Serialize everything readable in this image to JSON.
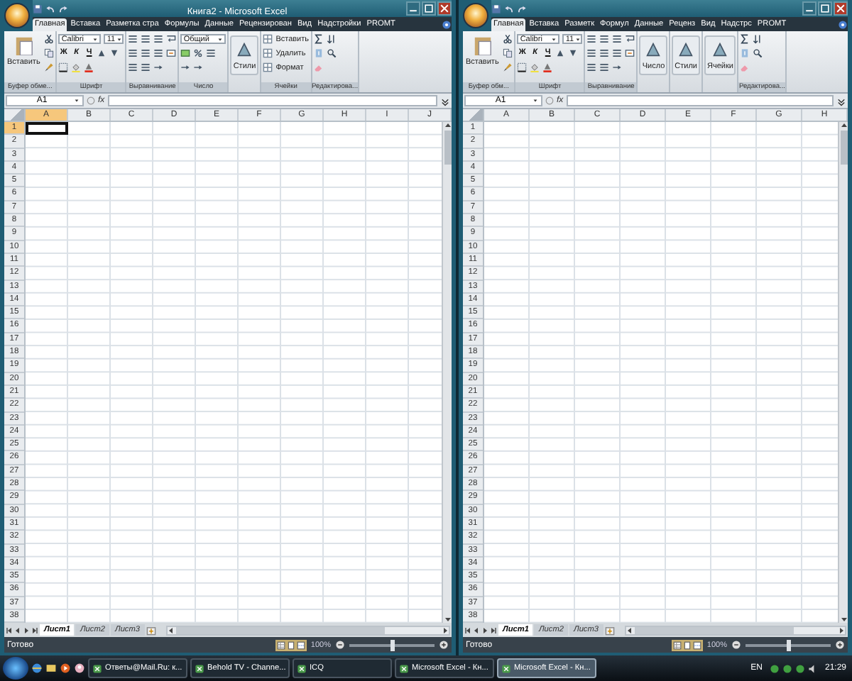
{
  "windows": [
    {
      "title": "Книга2 - Microsoft Excel",
      "tabs": [
        {
          "label": "Главная",
          "selected": true
        },
        {
          "label": "Вставка",
          "selected": false
        },
        {
          "label": "Разметка стра",
          "selected": false
        },
        {
          "label": "Формулы",
          "selected": false
        },
        {
          "label": "Данные",
          "selected": false
        },
        {
          "label": "Рецензирован",
          "selected": false
        },
        {
          "label": "Вид",
          "selected": false
        },
        {
          "label": "Надстройки",
          "selected": false
        },
        {
          "label": "PROMT",
          "selected": false
        }
      ],
      "ribbon": [
        {
          "kind": "clipboard",
          "label": "Буфер обме...",
          "button": "Вставить"
        },
        {
          "kind": "font",
          "label": "Шрифт",
          "font": "Calibri",
          "size": "11",
          "styles": [
            "Ж",
            "К",
            "Ч"
          ]
        },
        {
          "kind": "alignment",
          "label": "Выравнивание"
        },
        {
          "kind": "number",
          "label": "Число",
          "format": "Общий"
        },
        {
          "kind": "button",
          "button": "Стили"
        },
        {
          "kind": "cells",
          "label": "Ячейки",
          "commands": [
            "Вставить",
            "Удалить",
            "Формат"
          ]
        },
        {
          "kind": "editing",
          "label": "Редактирова..."
        }
      ],
      "name_box": "A1",
      "formula_label": "fx",
      "columns": [
        {
          "label": "A",
          "selected": true
        },
        {
          "label": "B",
          "selected": false
        },
        {
          "label": "C",
          "selected": false
        },
        {
          "label": "D",
          "selected": false
        },
        {
          "label": "E",
          "selected": false
        },
        {
          "label": "F",
          "selected": false
        },
        {
          "label": "G",
          "selected": false
        },
        {
          "label": "H",
          "selected": false
        },
        {
          "label": "I",
          "selected": false
        },
        {
          "label": "J",
          "selected": false
        }
      ],
      "rows": [
        {
          "label": "1",
          "selected": true
        },
        {
          "label": "2",
          "selected": false
        },
        {
          "label": "3",
          "selected": false
        },
        {
          "label": "4",
          "selected": false
        },
        {
          "label": "5",
          "selected": false
        },
        {
          "label": "6",
          "selected": false
        },
        {
          "label": "7",
          "selected": false
        },
        {
          "label": "8",
          "selected": false
        },
        {
          "label": "9",
          "selected": false
        },
        {
          "label": "10",
          "selected": false
        },
        {
          "label": "11",
          "selected": false
        },
        {
          "label": "12",
          "selected": false
        },
        {
          "label": "13",
          "selected": false
        },
        {
          "label": "14",
          "selected": false
        },
        {
          "label": "15",
          "selected": false
        },
        {
          "label": "16",
          "selected": false
        },
        {
          "label": "17",
          "selected": false
        },
        {
          "label": "18",
          "selected": false
        },
        {
          "label": "19",
          "selected": false
        },
        {
          "label": "20",
          "selected": false
        },
        {
          "label": "21",
          "selected": false
        },
        {
          "label": "22",
          "selected": false
        },
        {
          "label": "23",
          "selected": false
        },
        {
          "label": "24",
          "selected": false
        },
        {
          "label": "25",
          "selected": false
        },
        {
          "label": "26",
          "selected": false
        },
        {
          "label": "27",
          "selected": false
        },
        {
          "label": "28",
          "selected": false
        },
        {
          "label": "29",
          "selected": false
        },
        {
          "label": "30",
          "selected": false
        },
        {
          "label": "31",
          "selected": false
        },
        {
          "label": "32",
          "selected": false
        },
        {
          "label": "33",
          "selected": false
        },
        {
          "label": "34",
          "selected": false
        },
        {
          "label": "35",
          "selected": false
        },
        {
          "label": "36",
          "selected": false
        },
        {
          "label": "37",
          "selected": false
        },
        {
          "label": "38",
          "selected": false
        }
      ],
      "sheets": [
        {
          "label": "Лист1",
          "selected": true
        },
        {
          "label": "Лист2",
          "selected": false
        },
        {
          "label": "Лист3",
          "selected": false
        }
      ],
      "status": "Готово",
      "zoom": {
        "reading": "100%",
        "level": 0.5
      }
    },
    {
      "tabs": [
        {
          "label": "Главная",
          "selected": true
        },
        {
          "label": "Вставка",
          "selected": false
        },
        {
          "label": "Разметк",
          "selected": false
        },
        {
          "label": "Формул",
          "selected": false
        },
        {
          "label": "Данные",
          "selected": false
        },
        {
          "label": "Реценз",
          "selected": false
        },
        {
          "label": "Вид",
          "selected": false
        },
        {
          "label": "Надстрс",
          "selected": false
        },
        {
          "label": "PROMT",
          "selected": false
        }
      ],
      "ribbon": [
        {
          "kind": "clipboard",
          "label": "Буфер обм...",
          "button": "Вставить"
        },
        {
          "kind": "font",
          "label": "Шрифт",
          "font": "Calibri",
          "size": "11",
          "styles": [
            "Ж",
            "К",
            "Ч"
          ]
        },
        {
          "kind": "alignment",
          "label": "Выравнивание"
        },
        {
          "kind": "button",
          "button": "Число"
        },
        {
          "kind": "button",
          "button": "Стили"
        },
        {
          "kind": "button",
          "button": "Ячейки"
        },
        {
          "kind": "editing",
          "label": "Редактирова..."
        }
      ],
      "name_box": "A1",
      "formula_label": "fx",
      "columns": [
        {
          "label": "A",
          "selected": false
        },
        {
          "label": "B",
          "selected": false
        },
        {
          "label": "C",
          "selected": false
        },
        {
          "label": "D",
          "selected": false
        },
        {
          "label": "E",
          "selected": false
        },
        {
          "label": "F",
          "selected": false
        },
        {
          "label": "G",
          "selected": false
        },
        {
          "label": "H",
          "selected": false
        }
      ],
      "rows": [
        {
          "label": "1",
          "selected": false
        },
        {
          "label": "2",
          "selected": false
        },
        {
          "label": "3",
          "selected": false
        },
        {
          "label": "4",
          "selected": false
        },
        {
          "label": "5",
          "selected": false
        },
        {
          "label": "6",
          "selected": false
        },
        {
          "label": "7",
          "selected": false
        },
        {
          "label": "8",
          "selected": false
        },
        {
          "label": "9",
          "selected": false
        },
        {
          "label": "10",
          "selected": false
        },
        {
          "label": "11",
          "selected": false
        },
        {
          "label": "12",
          "selected": false
        },
        {
          "label": "13",
          "selected": false
        },
        {
          "label": "14",
          "selected": false
        },
        {
          "label": "15",
          "selected": false
        },
        {
          "label": "16",
          "selected": false
        },
        {
          "label": "17",
          "selected": false
        },
        {
          "label": "18",
          "selected": false
        },
        {
          "label": "19",
          "selected": false
        },
        {
          "label": "20",
          "selected": false
        },
        {
          "label": "21",
          "selected": false
        },
        {
          "label": "22",
          "selected": false
        },
        {
          "label": "23",
          "selected": false
        },
        {
          "label": "24",
          "selected": false
        },
        {
          "label": "25",
          "selected": false
        },
        {
          "label": "26",
          "selected": false
        },
        {
          "label": "27",
          "selected": false
        },
        {
          "label": "28",
          "selected": false
        },
        {
          "label": "29",
          "selected": false
        },
        {
          "label": "30",
          "selected": false
        },
        {
          "label": "31",
          "selected": false
        },
        {
          "label": "32",
          "selected": false
        },
        {
          "label": "33",
          "selected": false
        },
        {
          "label": "34",
          "selected": false
        },
        {
          "label": "35",
          "selected": false
        },
        {
          "label": "36",
          "selected": false
        },
        {
          "label": "37",
          "selected": false
        },
        {
          "label": "38",
          "selected": false
        }
      ],
      "sheets": [
        {
          "label": "Лист1",
          "selected": true
        },
        {
          "label": "Лист2",
          "selected": false
        },
        {
          "label": "Лист3",
          "selected": false
        }
      ],
      "status": "Готово",
      "zoom": {
        "reading": "100%",
        "level": 0.5
      }
    }
  ],
  "taskbar": {
    "tasks": [
      {
        "label": "Ответы@Mail.Ru: к...",
        "selected": false
      },
      {
        "label": "Behold TV - Channe...",
        "selected": false
      },
      {
        "label": "ICQ",
        "selected": false
      },
      {
        "label": "Microsoft Excel - Кн...",
        "selected": false
      },
      {
        "label": "Microsoft Excel - Кн...",
        "selected": true
      }
    ],
    "language": "EN",
    "clock": "21:29"
  }
}
